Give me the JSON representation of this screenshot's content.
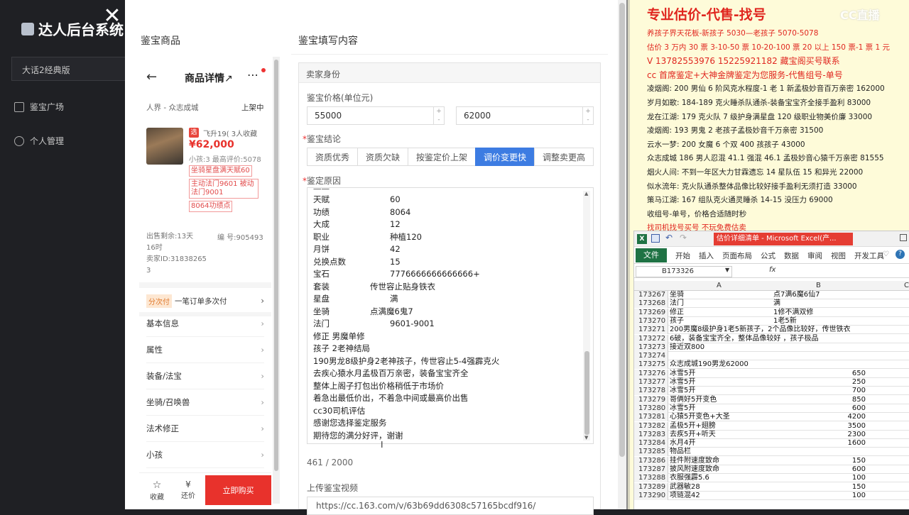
{
  "admin": {
    "brand": "达人后台系统",
    "select_value": "大话2经典版",
    "nav": [
      "鉴宝广场",
      "个人管理"
    ],
    "close_glyph": "✕"
  },
  "modal": {
    "left_title": "鉴宝商品",
    "right_title": "鉴宝填写内容"
  },
  "phone": {
    "header_title": "商品详情",
    "back_glyph": "←",
    "more_glyph": "⋯",
    "server": "人界 - 众志成城",
    "status": "上架中",
    "badge": "选",
    "name_line": "飞升19( 3人收藏",
    "price": "¥62,000",
    "subline": "小孩:3 最高评价:5078",
    "tags": [
      "坐骑星盘满天赋60",
      "主动法门9601 被动法门9001",
      "8064功绩点"
    ],
    "sale_left": "出售剩余:13天16时",
    "serial": "编 号:905493",
    "seller": "卖家ID:318382653",
    "installment_tag": "分次付",
    "installment_text": "一笔订单多次付",
    "sections": [
      "基本信息",
      "属性",
      "装备/法宝",
      "坐骑/召唤兽",
      "法术修正",
      "小孩"
    ],
    "fav_label": "收藏",
    "bargain_label": "还价",
    "buy_label": "立即购买"
  },
  "form": {
    "section": "卖家身份",
    "price_label": "鉴宝价格(单位元)",
    "price_min": "55000",
    "price_max": "62000",
    "conclusion_label": "鉴宝结论",
    "conclusions": [
      "资质优秀",
      "资质欠缺",
      "按鉴定价上架",
      "调价变更快",
      "调整卖更高"
    ],
    "active_conclusion": 3,
    "reason_label": "鉴定原因",
    "reason_rows": [
      {
        "k": "天赋",
        "v": "60"
      },
      {
        "k": "功绩",
        "v": "8064"
      },
      {
        "k": "大成",
        "v": "12"
      },
      {
        "k": "职业",
        "v": "种植120"
      },
      {
        "k": "月饼",
        "v": "42"
      },
      {
        "k": "兑换点数",
        "v": "15"
      },
      {
        "k": "宝石",
        "v": "7776666666666666+"
      },
      {
        "k": "套装",
        "v": "传世容止贴身铁衣"
      },
      {
        "k": "星盘",
        "v": "满"
      },
      {
        "k": "坐骑",
        "v": "点满魔6鬼7"
      },
      {
        "k": "法门",
        "v": "9601-9001"
      }
    ],
    "reason_lines": [
      "修正 男魔单修",
      "孩子                2老神结局",
      "190男龙8级护身2老神孩子，传世容止5-4强霹克火",
      "去疾心猿水月孟极百万亲密，装备宝宝齐全",
      "整体上阁子打包出价格稍低于市场价",
      "着急出最低价出，不着急中间或最高价出售",
      "cc30司机评估",
      "感谢您选择鉴定服务",
      "期待您的满分好评，谢谢"
    ],
    "counter": "461 / 2000",
    "video_label": "上传鉴宝视频",
    "video_url": "https://cc.163.com/v/63b69dd6308c57165bcdf916/"
  },
  "doc": {
    "title": "专业估价-代售-找号",
    "lines": [
      {
        "t": "养孩子界天花板-新孩子 5030—老孩子 5070-5078",
        "red": true
      },
      {
        "t": "估价 3 万内 30 票  3-10-50 票  10-20-100 票 20 以上 150 票-1 票 1 元",
        "red": true
      },
      {
        "t": "V 13782553976    15225921182  藏宝阁买号联系",
        "red": true,
        "big": true
      },
      {
        "t": "cc 首席鉴定+大神金牌鉴定为您服务-代售组号-单号",
        "red": true,
        "big": true
      },
      {
        "t": "凌烟阁: 200 男仙 6 阶风克水程度-1 老 1 新孟极妙音百万亲密 162000",
        "red": false
      },
      {
        "t": "岁月如歌: 184-189 克火睡杀队通杀-装备宝宝齐全接手盈利 83000",
        "red": false
      },
      {
        "t": "龙在江湖: 179 克火队 7 级护身满星盘 120 级职业物美价廉 33000",
        "red": false
      },
      {
        "t": "凌烟阁: 193 男鬼 2 老孩子孟极妙音千万亲密 31500",
        "red": false
      },
      {
        "t": "云水一梦: 200 女魔 6 个双 400 孩孩子 43000",
        "red": false
      },
      {
        "t": "众志成城 186 男人忍混 41.1 强混 46.1 孟极妙音心猿千万亲密 81555",
        "red": false
      },
      {
        "t": "烟火人间: 不到一年区大力甘霖遗忘 14 星队伍 15 和异光 22000",
        "red": false
      },
      {
        "t": "似水流年: 克火队通杀整体品像比较好接手盈利无须打造 33000",
        "red": false
      },
      {
        "t": "策马江湖: 167 组队克火通灵睡杀 14-15 没压力 69000",
        "red": false
      },
      {
        "t": "收组号-单号，价格合适随时秒",
        "red": false
      },
      {
        "t": "找司机找号买号 不玩免费估卖",
        "red": true
      }
    ]
  },
  "excel": {
    "title": "估价详细清单 - Microsoft Excel(产...",
    "ribbon": [
      "文件",
      "开始",
      "插入",
      "页面布局",
      "公式",
      "数据",
      "审阅",
      "视图",
      "开发工具"
    ],
    "namebox": "B173326",
    "fx": "fx",
    "col_a": "A",
    "col_b": "B",
    "col_c": "C",
    "rows": [
      {
        "n": "173267",
        "a": "坐骑",
        "b": "点7满6魔6仙7",
        "num": false
      },
      {
        "n": "173268",
        "a": "法门",
        "b": "满",
        "num": false
      },
      {
        "n": "173269",
        "a": "修正",
        "b": "1修不满双修",
        "num": false
      },
      {
        "n": "173270",
        "a": "孩子",
        "b": "1老5新",
        "num": false
      },
      {
        "n": "173271",
        "a": "200男魔8级护身1老5新孩子，2个品像比较好，传世铁衣",
        "b": "",
        "num": false
      },
      {
        "n": "173272",
        "a": "6破，装备宝宝齐全，整体品像较好 ，孩子极品",
        "b": "",
        "num": false
      },
      {
        "n": "173273",
        "a": "接近双800",
        "b": "",
        "num": false
      },
      {
        "n": "173274",
        "a": "",
        "b": "",
        "num": false
      },
      {
        "n": "173275",
        "a": "众志成城190男龙62000",
        "b": "",
        "num": false
      },
      {
        "n": "173276",
        "a": "冰雪5开",
        "b": "650",
        "num": true
      },
      {
        "n": "173277",
        "a": "冰雪5开",
        "b": "250",
        "num": true
      },
      {
        "n": "173278",
        "a": "冰雪5开",
        "b": "700",
        "num": true
      },
      {
        "n": "173279",
        "a": "哥俩好5开变色",
        "b": "850",
        "num": true
      },
      {
        "n": "173280",
        "a": "冰雪5开",
        "b": "600",
        "num": true
      },
      {
        "n": "173281",
        "a": "心猿5开变色+大圣",
        "b": "4200",
        "num": true
      },
      {
        "n": "173282",
        "a": "孟极5开+翅膀",
        "b": "3500",
        "num": true
      },
      {
        "n": "173283",
        "a": "去疾5开+听天",
        "b": "2300",
        "num": true
      },
      {
        "n": "173284",
        "a": "水月4开",
        "b": "1600",
        "num": true
      },
      {
        "n": "173285",
        "a": "物品栏",
        "b": "",
        "num": false
      },
      {
        "n": "173286",
        "a": "挂件附速度致命",
        "b": "150",
        "num": true
      },
      {
        "n": "173287",
        "a": "披风附速度致命",
        "b": "600",
        "num": true
      },
      {
        "n": "173288",
        "a": "衣服强霹5.6",
        "b": "100",
        "num": true
      },
      {
        "n": "173289",
        "a": "武器敏28",
        "b": "150",
        "num": true
      },
      {
        "n": "173290",
        "a": "项链混42",
        "b": "100",
        "num": true
      }
    ]
  },
  "watermark": "CC直播"
}
